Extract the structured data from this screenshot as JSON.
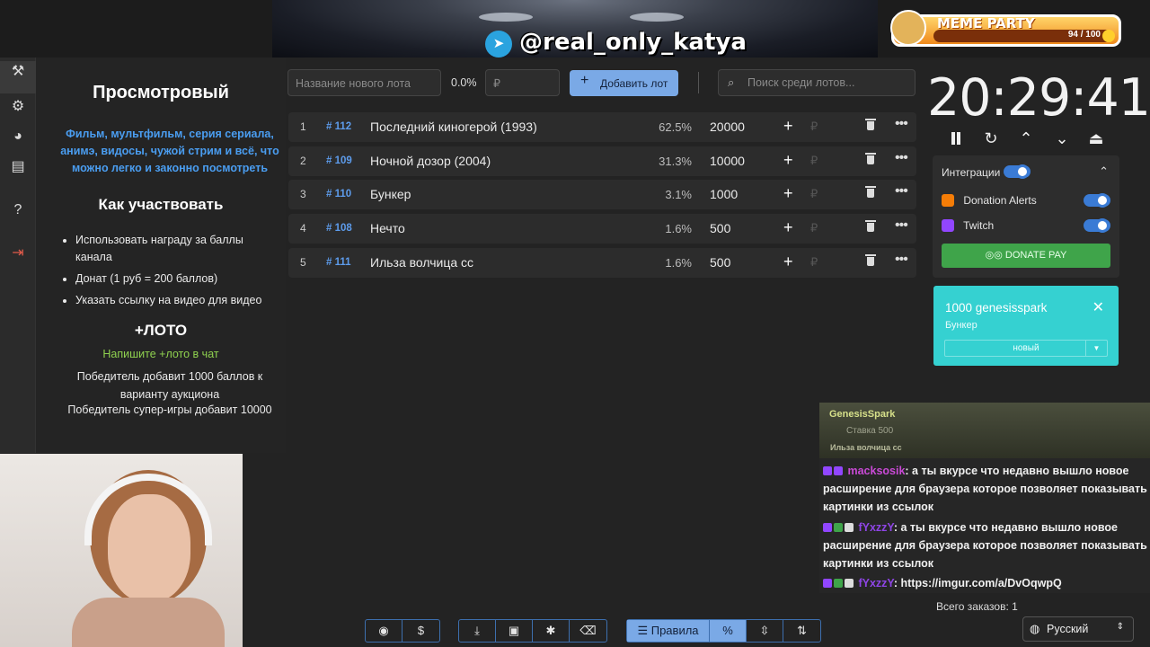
{
  "banner": {
    "telegram_handle": "@real_only_katya",
    "meme_party": {
      "title": "MEME PARTY",
      "progress": "94 / 100",
      "progress_fraction": 0.94
    }
  },
  "sidebar": {
    "icons": [
      "auction-icon",
      "gear-icon",
      "pie-chart-icon",
      "clipboard-icon",
      "help-icon",
      "logout-icon"
    ]
  },
  "rules": {
    "title": "Просмотровый",
    "description": "Фильм, мультфильм, серия сериала, анимэ, видосы, чужой стрим и всё, что можно легко и законно посмотреть",
    "how_title": "Как участвовать",
    "how_items": [
      "Использовать награду за баллы канала",
      "Донат (1 руб = 200 баллов)",
      "Указать ссылку на видео для видео"
    ],
    "loto_title": "+ЛОТО",
    "loto_command": "Напишите +лото в чат",
    "loto_win": "Победитель добавит 1000 баллов к варианту аукциона",
    "loto_super": "Победитель супер-игры добавит 10000"
  },
  "controls": {
    "new_lot_placeholder": "Название нового лота",
    "percent": "0.0%",
    "amount_placeholder": "₽",
    "add_lot_label": "Добавить лот",
    "search_placeholder": "Поиск среди лотов..."
  },
  "lots": [
    {
      "index": "1",
      "tag": "# 112",
      "name": "Последний киногерой (1993)",
      "percent": "62.5%",
      "amount": "20000"
    },
    {
      "index": "2",
      "tag": "# 109",
      "name": "Ночной дозор (2004)",
      "percent": "31.3%",
      "amount": "10000"
    },
    {
      "index": "3",
      "tag": "# 110",
      "name": "Бункер",
      "percent": "3.1%",
      "amount": "1000"
    },
    {
      "index": "4",
      "tag": "# 108",
      "name": "Нечто",
      "percent": "1.6%",
      "amount": "500"
    },
    {
      "index": "5",
      "tag": "# 111",
      "name": "Ильза волчица сс",
      "percent": "1.6%",
      "amount": "500"
    }
  ],
  "timer": {
    "value": "20:29:41"
  },
  "integrations": {
    "label": "Интеграции",
    "donation_alerts": "Donation Alerts",
    "twitch": "Twitch",
    "donate_pay": "DONATE PAY"
  },
  "notification": {
    "title": "1000 genesisspark",
    "subtitle": "Бункер",
    "select_value": "новый"
  },
  "chat": {
    "highlight": {
      "user": "GenesisSpark",
      "bet": "Ставка 500",
      "variant": "Ильза волчица сс"
    },
    "messages": [
      {
        "user": "macksosik",
        "text": ": а ты вкурсе что недавно вышло новое расширение для браузера которое позволяет показывать картинки из ссылок"
      },
      {
        "user": "fYxzzY",
        "text": ": а ты вкурсе что недавно вышло новое расширение для браузера которое позволяет показывать картинки из ссылок"
      },
      {
        "user": "fYxzzY",
        "text": ": https://imgur.com/a/DvOqwpQ"
      }
    ]
  },
  "footer": {
    "orders": "Всего заказов: 1",
    "language": "Русский",
    "rules_label": "Правила"
  },
  "colors": {
    "accent": "#7aa9e6",
    "teal_card": "#35d1d1",
    "donate_pay": "#3fa44a",
    "link_blue": "#4a9df0"
  }
}
